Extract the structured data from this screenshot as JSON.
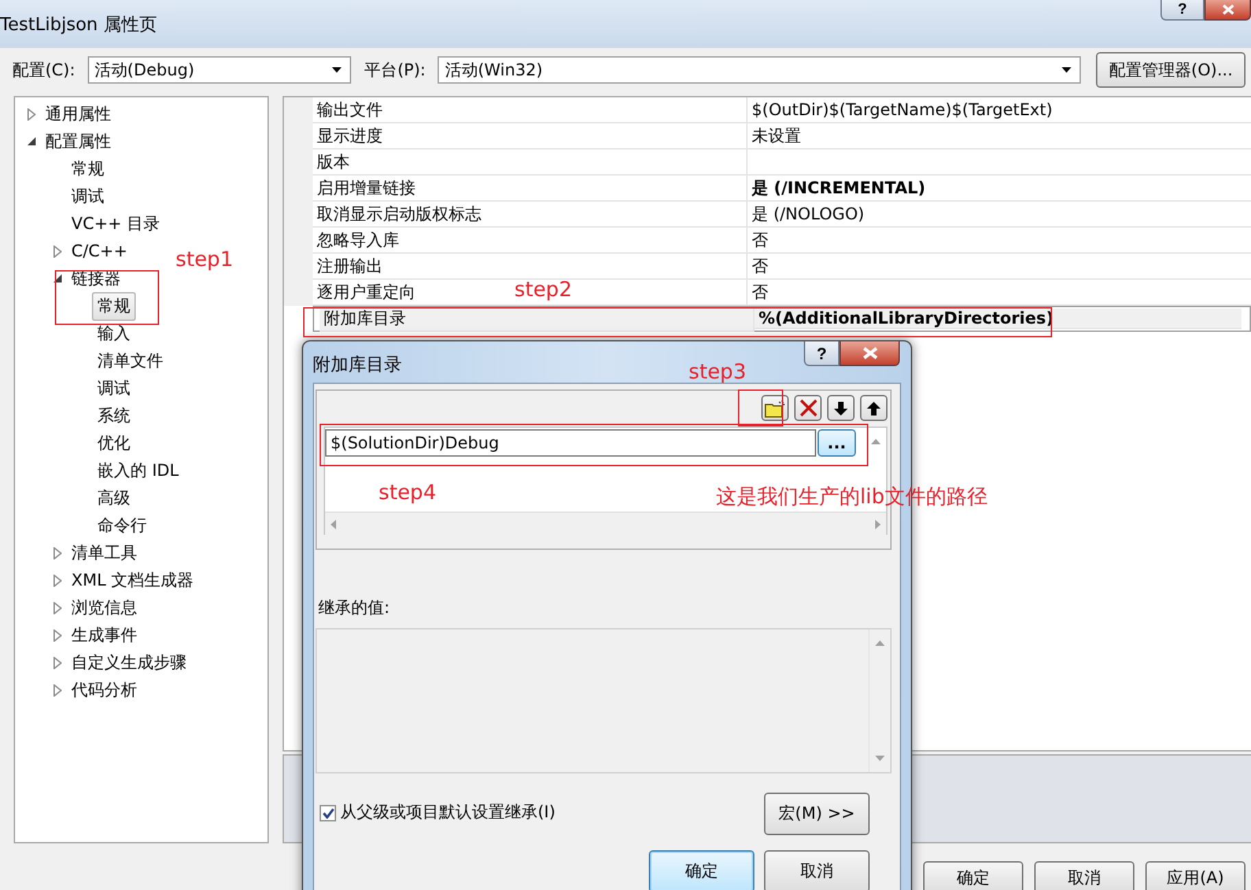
{
  "window": {
    "title": "TestLibjson 属性页",
    "help_button": "?"
  },
  "config": {
    "label": "配置(C):",
    "value": "活动(Debug)"
  },
  "platform": {
    "label": "平台(P):",
    "value": "活动(Win32)"
  },
  "config_manager_button": "配置管理器(O)...",
  "tree": [
    {
      "label": "通用属性",
      "expandable": true,
      "expanded": false,
      "selected": false
    },
    {
      "label": "配置属性",
      "expandable": true,
      "expanded": true,
      "selected": false,
      "children": [
        {
          "label": "常规",
          "expandable": false,
          "selected": false
        },
        {
          "label": "调试",
          "expandable": false,
          "selected": false
        },
        {
          "label": "VC++ 目录",
          "expandable": false,
          "selected": false
        },
        {
          "label": "C/C++",
          "expandable": true,
          "expanded": false,
          "selected": false
        },
        {
          "label": "链接器",
          "expandable": true,
          "expanded": true,
          "selected": false,
          "children": [
            {
              "label": "常规",
              "expandable": false,
              "selected": true
            },
            {
              "label": "输入",
              "expandable": false,
              "selected": false
            },
            {
              "label": "清单文件",
              "expandable": false,
              "selected": false
            },
            {
              "label": "调试",
              "expandable": false,
              "selected": false
            },
            {
              "label": "系统",
              "expandable": false,
              "selected": false
            },
            {
              "label": "优化",
              "expandable": false,
              "selected": false
            },
            {
              "label": "嵌入的 IDL",
              "expandable": false,
              "selected": false
            },
            {
              "label": "高级",
              "expandable": false,
              "selected": false
            },
            {
              "label": "命令行",
              "expandable": false,
              "selected": false
            }
          ]
        },
        {
          "label": "清单工具",
          "expandable": true,
          "expanded": false,
          "selected": false
        },
        {
          "label": "XML 文档生成器",
          "expandable": true,
          "expanded": false,
          "selected": false
        },
        {
          "label": "浏览信息",
          "expandable": true,
          "expanded": false,
          "selected": false
        },
        {
          "label": "生成事件",
          "expandable": true,
          "expanded": false,
          "selected": false
        },
        {
          "label": "自定义生成步骤",
          "expandable": true,
          "expanded": false,
          "selected": false
        },
        {
          "label": "代码分析",
          "expandable": true,
          "expanded": false,
          "selected": false
        }
      ]
    }
  ],
  "grid": {
    "rows": [
      {
        "name": "输出文件",
        "value": "$(OutDir)$(TargetName)$(TargetExt)",
        "modified": false,
        "selected": false
      },
      {
        "name": "显示进度",
        "value": "未设置",
        "modified": false,
        "selected": false
      },
      {
        "name": "版本",
        "selected": false
      },
      {
        "name": "启用增量链接",
        "value": "是 (/INCREMENTAL)",
        "modified": true,
        "selected": false
      },
      {
        "name": "取消显示启动版权标志",
        "value": "是 (/NOLOGO)",
        "modified": false,
        "selected": false
      },
      {
        "name": "忽略导入库",
        "value": "否",
        "modified": false,
        "selected": false
      },
      {
        "name": "注册输出",
        "value": "否",
        "modified": false,
        "selected": false
      },
      {
        "name": "逐用户重定向",
        "value": "否",
        "modified": false,
        "selected": false
      },
      {
        "name": "附加库目录",
        "value": "%(AdditionalLibraryDirectories)",
        "modified": true,
        "selected": true
      }
    ]
  },
  "buttons": [
    "确定",
    "取消",
    "应用(A)"
  ],
  "dialog": {
    "title": "附加库目录",
    "help_button": "?",
    "toolbar": [
      {
        "kind": "new-folder"
      },
      {
        "kind": "delete"
      },
      {
        "kind": "down"
      },
      {
        "kind": "up"
      }
    ],
    "entries": [
      {
        "value": "$(SolutionDir)Debug"
      }
    ],
    "browse_button": "...",
    "inherited_label": "继承的值:",
    "inherit_checkbox": {
      "label": "从父级或项目默认设置继承(I)",
      "checked": true
    },
    "macro_button": "宏(M) >>",
    "ok_button": "确定",
    "cancel_button": "取消"
  },
  "annotations": [
    {
      "kind": "label",
      "text": "step1"
    },
    {
      "kind": "frame"
    },
    {
      "kind": "label",
      "text": "step2"
    },
    {
      "kind": "frame"
    },
    {
      "kind": "label",
      "text": "step3"
    },
    {
      "kind": "frame"
    },
    {
      "kind": "frame"
    },
    {
      "kind": "label",
      "text": "step4"
    },
    {
      "kind": "label",
      "text": "这是我们生产的lib文件的路径"
    }
  ]
}
